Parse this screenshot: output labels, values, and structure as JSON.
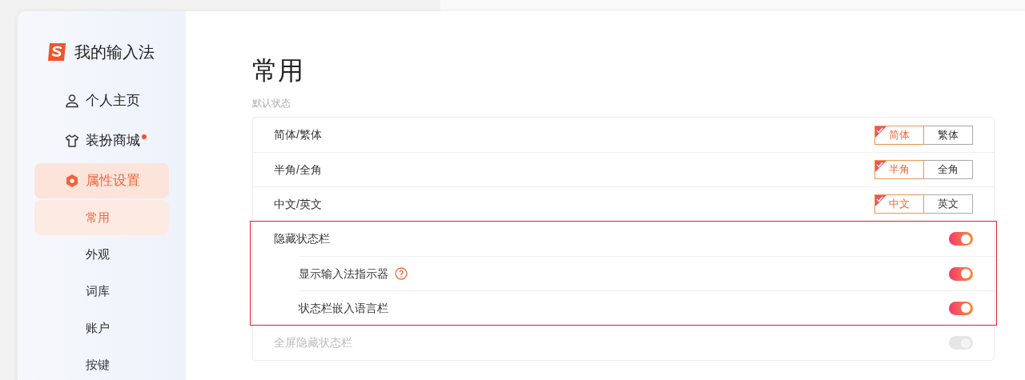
{
  "app": {
    "title": "我的输入法"
  },
  "sidebar": {
    "items": [
      {
        "label": "个人主页",
        "selected": false,
        "badge": false
      },
      {
        "label": "装扮商城",
        "selected": false,
        "badge": true
      },
      {
        "label": "属性设置",
        "selected": true,
        "badge": false,
        "children": [
          {
            "label": "常用",
            "selected": true
          },
          {
            "label": "外观",
            "selected": false
          },
          {
            "label": "词库",
            "selected": false
          },
          {
            "label": "账户",
            "selected": false
          },
          {
            "label": "按键",
            "selected": false
          }
        ]
      }
    ]
  },
  "page": {
    "title": "常用",
    "section": "默认状态",
    "rows": [
      {
        "kind": "segment",
        "label": "简体/繁体",
        "options": [
          {
            "label": "简体",
            "selected": true
          },
          {
            "label": "繁体",
            "selected": false
          }
        ]
      },
      {
        "kind": "segment",
        "label": "半角/全角",
        "options": [
          {
            "label": "半角",
            "selected": true
          },
          {
            "label": "全角",
            "selected": false
          }
        ]
      },
      {
        "kind": "segment",
        "label": "中文/英文",
        "options": [
          {
            "label": "中文",
            "selected": true
          },
          {
            "label": "英文",
            "selected": false
          }
        ]
      },
      {
        "kind": "group",
        "highlighted": true,
        "label": "隐藏状态栏",
        "on": true,
        "disabled": false,
        "children": [
          {
            "label": "显示输入法指示器",
            "on": true,
            "disabled": false,
            "help": true
          },
          {
            "label": "状态栏嵌入语言栏",
            "on": true,
            "disabled": false,
            "help": false
          }
        ]
      },
      {
        "kind": "toggle",
        "label": "全屏隐藏状态栏",
        "on": true,
        "disabled": true
      }
    ]
  }
}
